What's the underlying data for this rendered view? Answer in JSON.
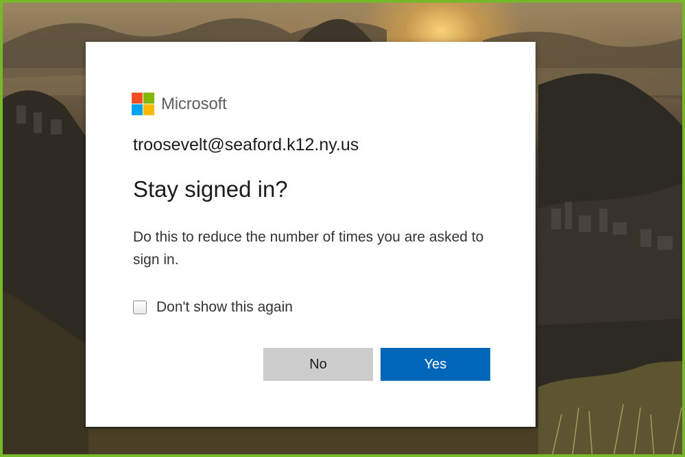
{
  "brand": {
    "name": "Microsoft",
    "logo_colors": [
      "#f25022",
      "#7fba00",
      "#00a4ef",
      "#ffb900"
    ]
  },
  "account": {
    "email": "troosevelt@seaford.k12.ny.us"
  },
  "dialog": {
    "title": "Stay signed in?",
    "description": "Do this to reduce the number of times you are asked to sign in.",
    "checkbox_label": "Don't show this again",
    "checkbox_checked": false,
    "no_label": "No",
    "yes_label": "Yes"
  },
  "colors": {
    "primary_button": "#0067b8",
    "secondary_button": "#cccccc",
    "frame_border": "#76b82a"
  }
}
